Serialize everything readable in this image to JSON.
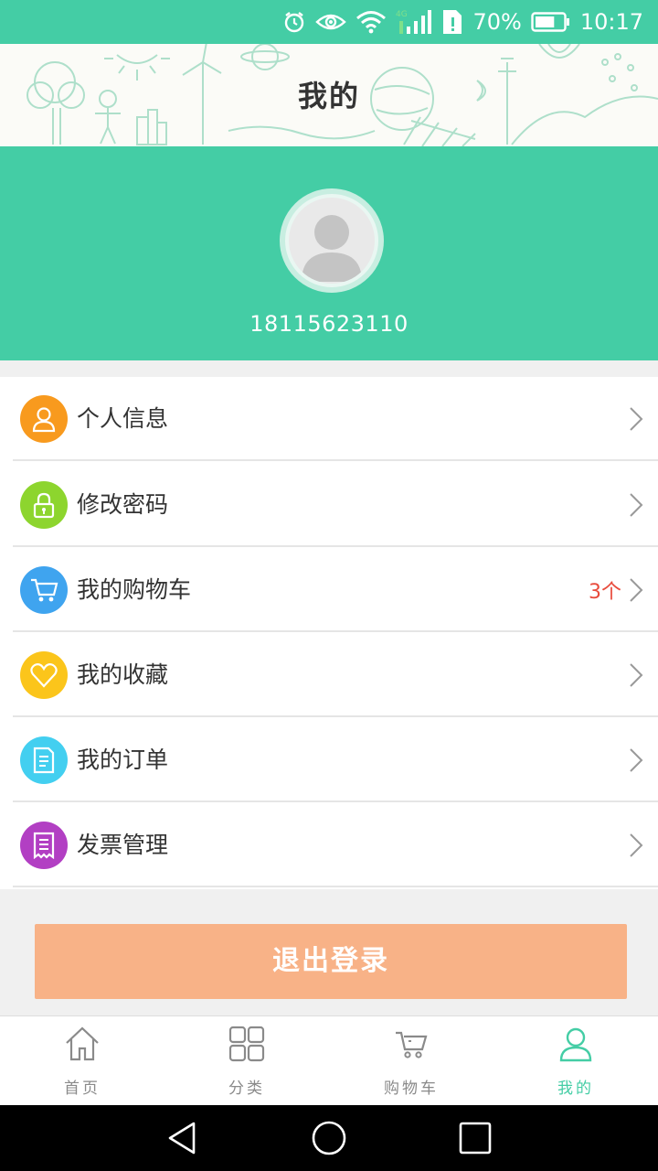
{
  "status_bar": {
    "battery_percent": "70%",
    "battery_level": 0.7,
    "time": "10:17",
    "icons": [
      "alarm-icon",
      "eye-icon",
      "wifi-icon",
      "signal-icon",
      "sim-alert-icon",
      "battery-icon"
    ]
  },
  "header": {
    "title": "我的"
  },
  "profile": {
    "phone": "18115623110",
    "avatar_icon": "default-avatar-icon"
  },
  "menu": {
    "items": [
      {
        "label": "个人信息",
        "icon": "user-icon",
        "color": "#f89a1e"
      },
      {
        "label": "修改密码",
        "icon": "lock-icon",
        "color": "#8dd52e"
      },
      {
        "label": "我的购物车",
        "icon": "cart-icon",
        "color": "#3fa4ef",
        "badge": "3个"
      },
      {
        "label": "我的收藏",
        "icon": "heart-icon",
        "color": "#fbc51b"
      },
      {
        "label": "我的订单",
        "icon": "document-icon",
        "color": "#43cff0"
      },
      {
        "label": "发票管理",
        "icon": "receipt-icon",
        "color": "#b23fc3"
      }
    ]
  },
  "logout": {
    "label": "退出登录"
  },
  "tabbar": {
    "tabs": [
      {
        "label": "首页",
        "icon": "home-icon"
      },
      {
        "label": "分类",
        "icon": "grid-icon"
      },
      {
        "label": "购物车",
        "icon": "cart-icon"
      },
      {
        "label": "我的",
        "icon": "user-icon",
        "active": true
      }
    ]
  },
  "colors": {
    "brand": "#44cda5",
    "logout": "#f8b287",
    "badge": "#e84b3c"
  }
}
